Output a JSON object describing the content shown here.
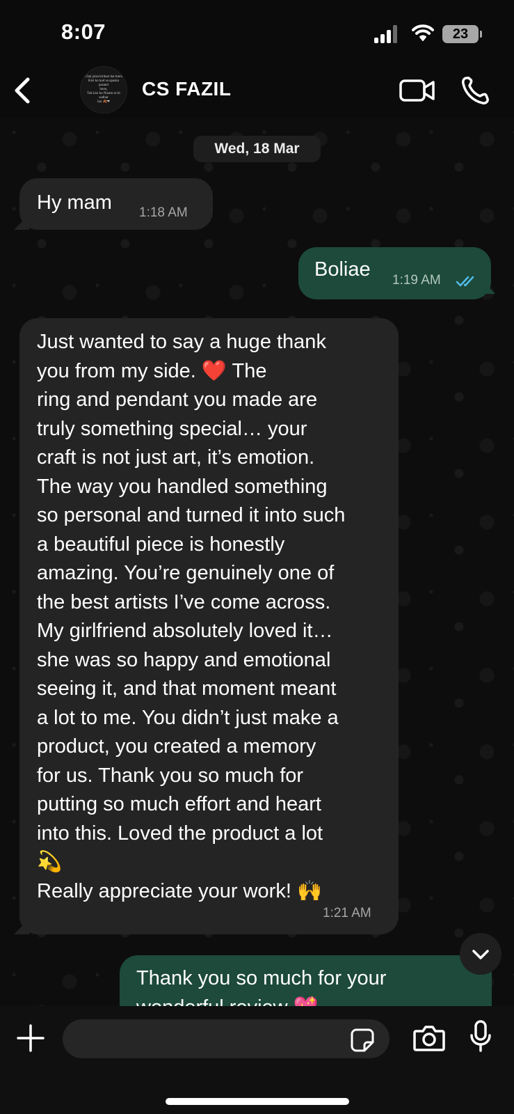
{
  "status_bar": {
    "time": "8:07",
    "battery": "23"
  },
  "header": {
    "contact_name": "CS FAZIL",
    "avatar_caption": "Chai jaisa kirdaar hai mera\nKisi ko kud sa upaska pasand\nhoon,\nTok kisi ko Nizam se bi sudhar\nhai 🍂❤"
  },
  "date_chip": "Wed, 18 Mar",
  "messages": [
    {
      "direction": "incoming",
      "text": "Hy mam",
      "time": "1:18 AM"
    },
    {
      "direction": "outgoing",
      "text": "Boliae",
      "time": "1:19 AM",
      "status": "read"
    },
    {
      "direction": "incoming",
      "text": "Just wanted to say a huge thank\nyou from my side. ❤️ The\nring and pendant you made are\ntruly something special… your\ncraft is not just art, it’s emotion.\nThe way you handled something\nso personal and turned it into such\na beautiful piece is honestly\namazing. You’re genuinely one of\nthe best artists I’ve come across.\nMy girlfriend absolutely loved it…\nshe was so happy and emotional\nseeing it, and that moment meant\na lot to me. You didn’t just make a\nproduct, you created a memory\nfor us. Thank you so much for\nputting so much effort and heart\ninto this. Loved the product a lot\n💫\nReally appreciate your work! 🙌",
      "time": "1:21 AM"
    },
    {
      "direction": "outgoing",
      "text": "Thank you so much for your\nwonderful review 💖",
      "time": ""
    }
  ],
  "icons": {
    "back": "chevron-left-icon",
    "video": "video-camera-icon",
    "call": "phone-icon",
    "read_receipt": "double-check-icon",
    "scroll": "chevron-down-icon",
    "plus": "plus-icon",
    "sticker": "sticker-icon",
    "camera": "camera-icon",
    "mic": "microphone-icon"
  },
  "colors": {
    "incoming_bubble": "#242424",
    "outgoing_bubble": "#1d4a3a",
    "read_tick": "#53bdeb",
    "background": "#0b0b0b"
  }
}
